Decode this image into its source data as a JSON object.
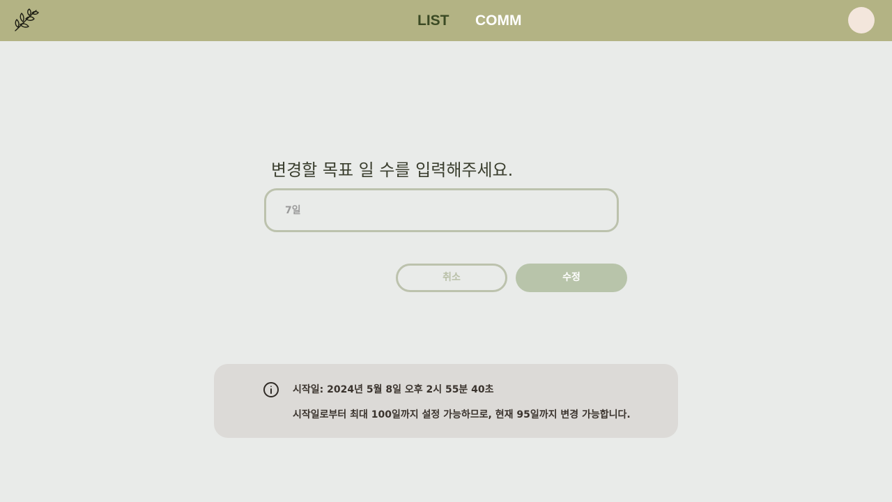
{
  "header": {
    "logo_icon": "leaf-branch-icon",
    "nav": [
      {
        "label": "LIST",
        "active": true
      },
      {
        "label": "COMM",
        "active": false
      }
    ],
    "avatar_icon": "user-avatar",
    "background_color": "#b3b384"
  },
  "form": {
    "prompt": "변경할 목표 일 수를 입력해주세요.",
    "days_input": {
      "value": "",
      "placeholder": "7일"
    },
    "cancel_label": "취소",
    "submit_label": "수정"
  },
  "info": {
    "icon": "info-circle-icon",
    "start_date_text": "시작일: 2024년 5월 8일 오후 2시 55분 40초",
    "limit_text": "시작일로부터 최대 100일까지 설정 가능하므로, 현재 95일까지 변경 가능합니다."
  }
}
